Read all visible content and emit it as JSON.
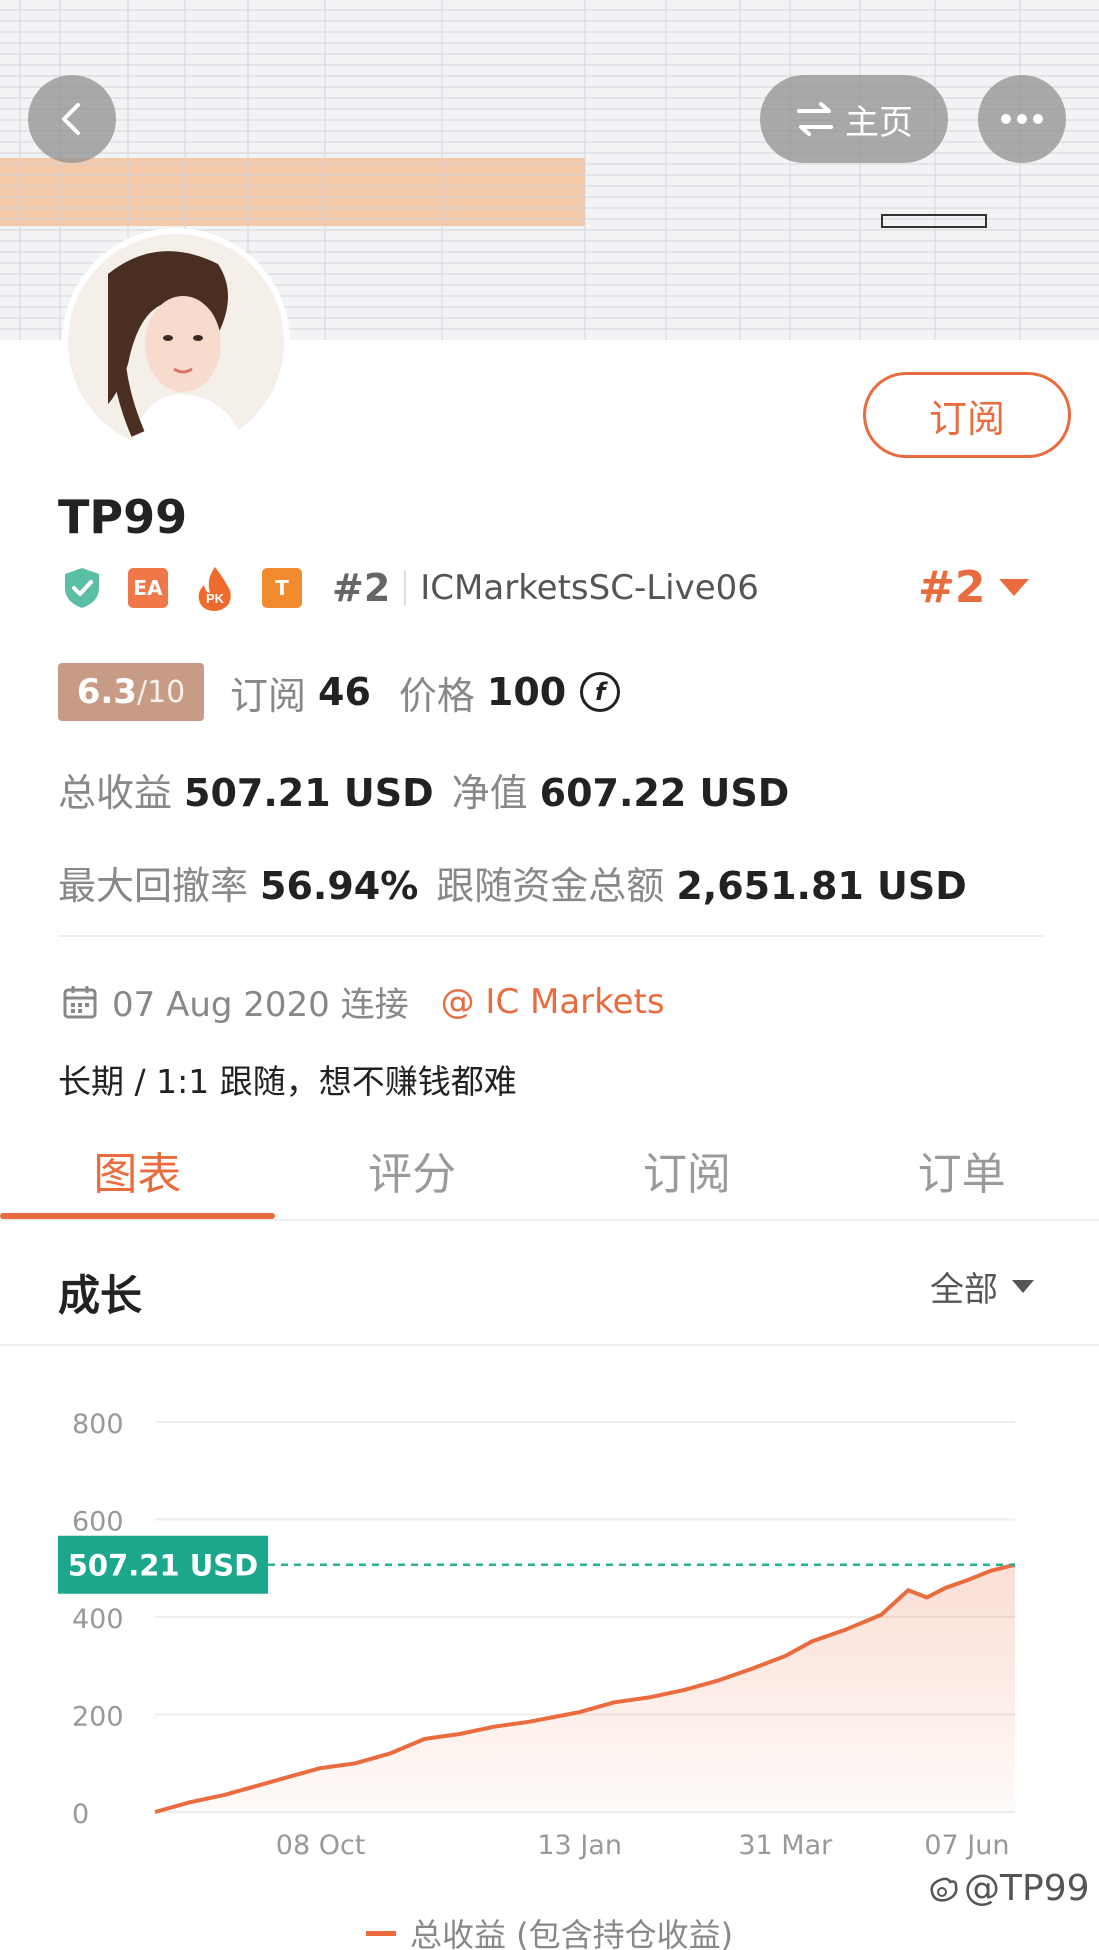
{
  "header": {
    "home_label": "主页",
    "home_icon": "swap-arrows-icon",
    "back_icon": "chevron-left-icon",
    "more_icon": "more-dots-icon"
  },
  "profile": {
    "subscribe_label": "订阅",
    "name": "TP99",
    "rank_badge": "#2",
    "server": "ICMarketsSC-Live06",
    "rank_right": "#2",
    "badges": [
      {
        "icon": "shield-check-icon",
        "color": "#5bbfa5"
      },
      {
        "text": "EA",
        "color": "#ef7748"
      },
      {
        "text": "PK",
        "icon": "fire-icon",
        "color": "#ef6a2d"
      },
      {
        "text": "T",
        "color": "#f28a2f"
      }
    ]
  },
  "stats": {
    "score": "6.3",
    "score_den": "/10",
    "subs_label": "订阅",
    "subs_value": "46",
    "price_label": "价格",
    "price_value": "100",
    "coin_symbol": "f",
    "total_profit_label": "总收益",
    "total_profit_value": "507.21 USD",
    "equity_label": "净值",
    "equity_value": "607.22 USD",
    "max_dd_label": "最大回撤率",
    "max_dd_value": "56.94%",
    "follow_label": "跟随资金总额",
    "follow_value": "2,651.81 USD"
  },
  "connect": {
    "date_text": "07 Aug 2020 连接",
    "broker_text": "@ IC Markets",
    "calendar_icon": "calendar-icon"
  },
  "description": "长期 / 1:1 跟随，想不赚钱都难",
  "tabs": [
    {
      "label": "图表",
      "active": true
    },
    {
      "label": "评分",
      "active": false
    },
    {
      "label": "订阅",
      "active": false
    },
    {
      "label": "订单",
      "active": false
    }
  ],
  "section": {
    "title": "成长",
    "range": "全部"
  },
  "accent_color": "#ea6b3d",
  "chart_data": {
    "type": "area",
    "title": "",
    "xlabel": "",
    "ylabel": "",
    "ylim": [
      0,
      800
    ],
    "yticks": [
      0,
      200,
      400,
      600,
      800
    ],
    "xticks": [
      "08 Oct",
      "13 Jan",
      "31 Mar",
      "07 Jun"
    ],
    "current_value_label": "507.21 USD",
    "current_value": 507.21,
    "legend_position": "bottom",
    "series": [
      {
        "name": "总收益 (包含持仓收益)",
        "color": "#ea6b3d",
        "x": [
          "07 Aug 2020",
          "20 Aug 2020",
          "02 Sep 2020",
          "15 Sep 2020",
          "28 Sep 2020",
          "08 Oct 2020",
          "21 Oct 2020",
          "03 Nov 2020",
          "16 Nov 2020",
          "29 Nov 2020",
          "12 Dec 2020",
          "25 Dec 2020",
          "13 Jan 2021",
          "26 Jan 2021",
          "08 Feb 2021",
          "21 Feb 2021",
          "06 Mar 2021",
          "19 Mar 2021",
          "31 Mar 2021",
          "10 Apr 2021",
          "23 Apr 2021",
          "06 May 2021",
          "16 May 2021",
          "23 May 2021",
          "30 May 2021",
          "07 Jun 2021",
          "16 Jun 2021",
          "25 Jun 2021"
        ],
        "y": [
          0,
          20,
          35,
          55,
          75,
          90,
          100,
          120,
          150,
          160,
          175,
          185,
          205,
          225,
          235,
          250,
          270,
          295,
          320,
          350,
          375,
          405,
          455,
          440,
          460,
          475,
          495,
          507.21
        ]
      }
    ]
  },
  "watermark": "@TP99"
}
